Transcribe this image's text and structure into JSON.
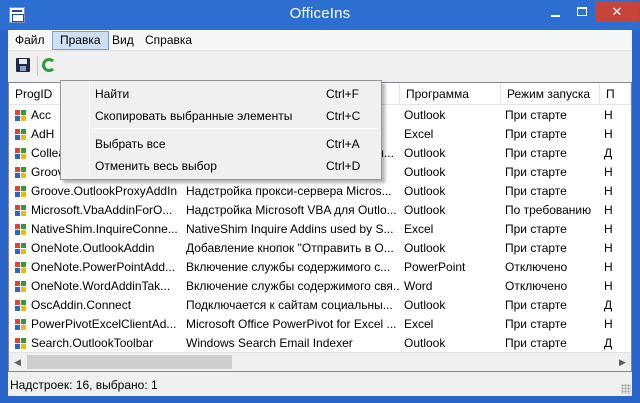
{
  "window": {
    "title": "OfficeIns"
  },
  "menu": [
    "Файл",
    "Правка",
    "Вид",
    "Справка"
  ],
  "dropdown": [
    {
      "label": "Найти",
      "shortcut": "Ctrl+F"
    },
    {
      "label": "Скопировать выбранные элементы",
      "shortcut": "Ctrl+C"
    },
    {
      "label": "Выбрать все",
      "shortcut": "Ctrl+A"
    },
    {
      "label": "Отменить весь выбор",
      "shortcut": "Ctrl+D"
    }
  ],
  "columns": [
    "ProgID",
    "",
    "Программа",
    "Режим запуска",
    "П"
  ],
  "rows": [
    {
      "progid": "Acc",
      "desc": "",
      "program": "Outlook",
      "mode": "При старте",
      "extra": "Н"
    },
    {
      "progid": "AdH",
      "desc": "",
      "program": "Excel",
      "mode": "При старте",
      "extra": "Н"
    },
    {
      "progid": "ColleagueImport.Colleag...",
      "desc": "Эта надстройка позволяет импорти...",
      "program": "Outlook",
      "mode": "При старте",
      "extra": "Д"
    },
    {
      "progid": "Groove.OutlookProxyAddIn",
      "desc": "",
      "program": "Outlook",
      "mode": "При старте",
      "extra": "Н"
    },
    {
      "progid": "Groove.OutlookProxyAddIn",
      "desc": "Надстройка прокси-сервера Micros...",
      "program": "Outlook",
      "mode": "При старте",
      "extra": "Н"
    },
    {
      "progid": "Microsoft.VbaAddinForO...",
      "desc": "Надстройка Microsoft VBA для Outlo...",
      "program": "Outlook",
      "mode": "По требованию",
      "extra": "Н"
    },
    {
      "progid": "NativeShim.InquireConne...",
      "desc": "NativeShim Inquire Addins used by S...",
      "program": "Excel",
      "mode": "При старте",
      "extra": "Н"
    },
    {
      "progid": "OneNote.OutlookAddin",
      "desc": "Добавление кнопок \"Отправить в О...",
      "program": "Outlook",
      "mode": "При старте",
      "extra": "Н"
    },
    {
      "progid": "OneNote.PowerPointAdd...",
      "desc": "Включение службы содержимого с...",
      "program": "PowerPoint",
      "mode": "Отключено",
      "extra": "Н"
    },
    {
      "progid": "OneNote.WordAddinTak...",
      "desc": "Включение службы содержимого свя...",
      "program": "Word",
      "mode": "Отключено",
      "extra": "Н"
    },
    {
      "progid": "OscAddin.Connect",
      "desc": "Подключается к сайтам социальны...",
      "program": "Outlook",
      "mode": "При старте",
      "extra": "Д"
    },
    {
      "progid": "PowerPivotExcelClientAd...",
      "desc": "Microsoft Office PowerPivot for Excel ...",
      "program": "Excel",
      "mode": "При старте",
      "extra": "Н"
    },
    {
      "progid": "Search.OutlookToolbar",
      "desc": "Windows Search Email Indexer",
      "program": "Outlook",
      "mode": "При старте",
      "extra": "Д"
    }
  ],
  "status": "Надстроек: 16, выбрано: 1"
}
